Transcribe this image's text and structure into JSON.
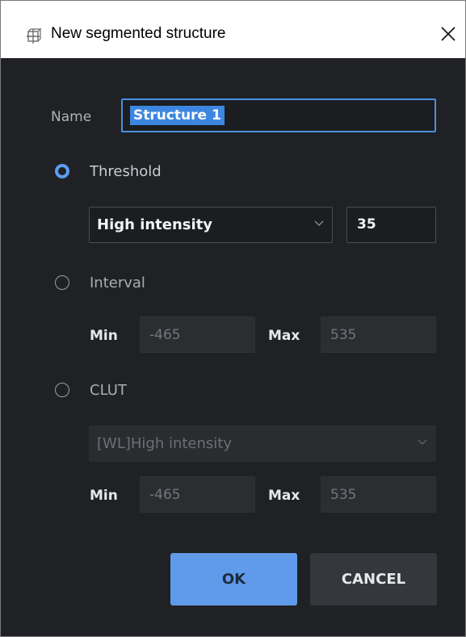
{
  "window": {
    "title": "New segmented structure"
  },
  "name": {
    "label": "Name",
    "value": "Structure 1"
  },
  "threshold": {
    "label": "Threshold",
    "selected": true,
    "mode": "High intensity",
    "value": "35"
  },
  "interval": {
    "label": "Interval",
    "selected": false,
    "min_label": "Min",
    "min_value": "-465",
    "max_label": "Max",
    "max_value": "535"
  },
  "clut": {
    "label": "CLUT",
    "selected": false,
    "preset": "[WL]High intensity",
    "min_label": "Min",
    "min_value": "-465",
    "max_label": "Max",
    "max_value": "535"
  },
  "buttons": {
    "ok": "OK",
    "cancel": "CANCEL"
  },
  "colors": {
    "accent": "#5f9bea",
    "background": "#1f2124",
    "selection": "#3d86e0"
  },
  "icons": [
    "structure-icon",
    "close-icon",
    "chevron-down-icon"
  ]
}
